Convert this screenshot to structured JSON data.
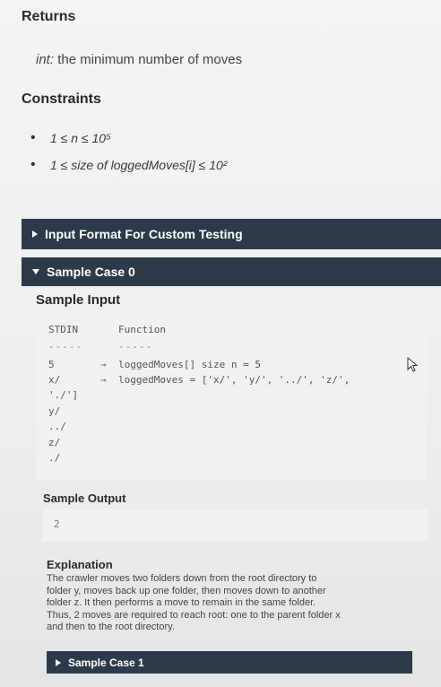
{
  "returns": {
    "title": "Returns",
    "type": "int:",
    "description": "the minimum number of moves"
  },
  "constraints": {
    "title": "Constraints",
    "items": [
      "1 ≤ n ≤ 10⁵",
      "1 ≤ size of loggedMoves[i] ≤ 10²"
    ]
  },
  "input_format": {
    "label": "Input Format For Custom Testing",
    "state": "collapsed"
  },
  "sample0": {
    "label": "Sample Case 0",
    "state": "expanded",
    "input_title": "Sample Input",
    "stdin_header": "STDIN",
    "function_header": "Function",
    "dashes": "-----",
    "stdin_lines": [
      "5",
      "x/",
      "'./']",
      "y/",
      "../",
      "z/",
      "./"
    ],
    "function_lines": [
      "loggedMoves[] size n = 5",
      "loggedMoves = ['x/', 'y/', '../', 'z/',"
    ],
    "output_title": "Sample Output",
    "output_value": "2",
    "explanation_title": "Explanation",
    "explanation_lines": [
      "The crawler moves two folders down from the root directory to",
      "folder y, moves back up one folder, then moves down to another",
      "folder z. It then performs a move to remain in the same folder.",
      "Thus, 2 moves are required to reach root: one to the parent folder x",
      "and then to the root directory."
    ]
  },
  "sample1": {
    "label": "Sample Case 1",
    "state": "collapsed"
  },
  "colors": {
    "bar_bg": "#2d3a4a",
    "page_bg": "#eeefef"
  },
  "icons": {
    "cursor": "mouse-pointer-icon"
  }
}
